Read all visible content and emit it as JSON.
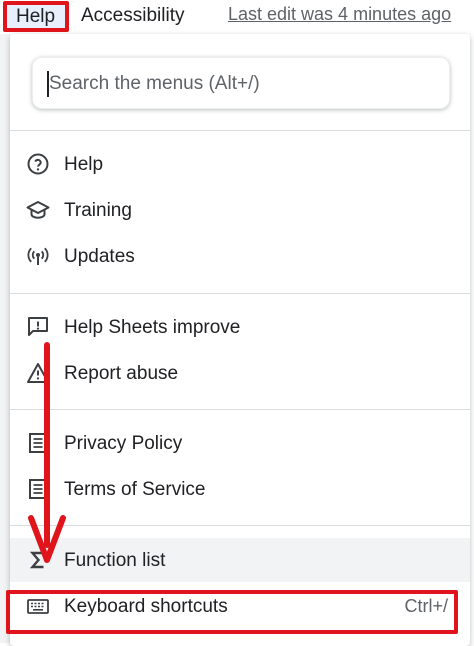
{
  "menubar": {
    "help_label": "Help",
    "accessibility_label": "Accessibility",
    "last_edit": "Last edit was 4 minutes ago"
  },
  "dropdown": {
    "search": {
      "value": "",
      "placeholder": "Search the menus (Alt+/)"
    },
    "sections": [
      {
        "items": [
          {
            "label": "Help",
            "icon": "help-circle-icon"
          },
          {
            "label": "Training",
            "icon": "school-icon"
          },
          {
            "label": "Updates",
            "icon": "broadcast-icon"
          }
        ]
      },
      {
        "items": [
          {
            "label": "Help Sheets improve",
            "icon": "feedback-icon"
          },
          {
            "label": "Report abuse",
            "icon": "warning-icon"
          }
        ]
      },
      {
        "items": [
          {
            "label": "Privacy Policy",
            "icon": "document-icon"
          },
          {
            "label": "Terms of Service",
            "icon": "document-icon"
          }
        ]
      },
      {
        "items": [
          {
            "label": "Function list",
            "icon": "sigma-icon"
          },
          {
            "label": "Keyboard shortcuts",
            "icon": "keyboard-icon",
            "shortcut": "Ctrl+/"
          }
        ]
      }
    ]
  },
  "annotation_color": "#e0151b"
}
